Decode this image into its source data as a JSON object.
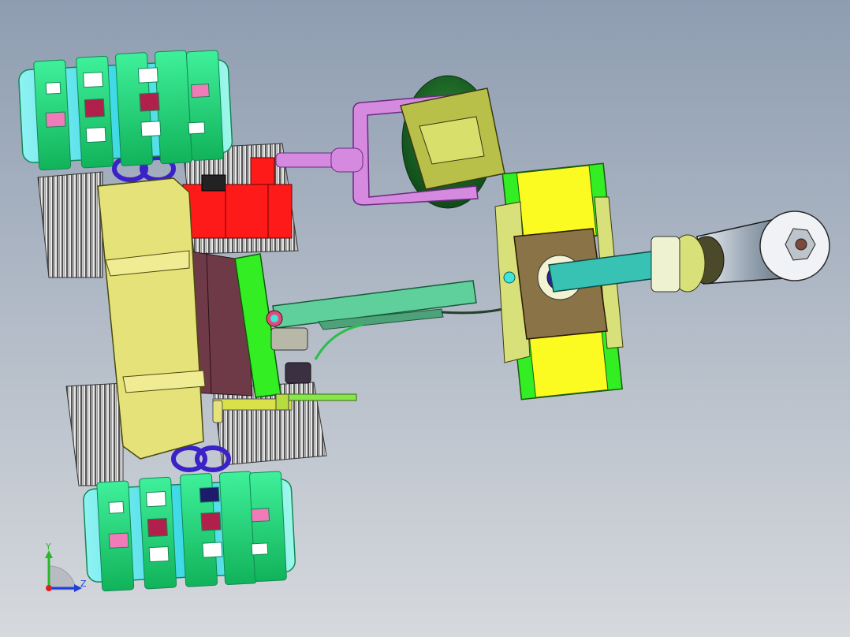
{
  "viewport": {
    "background_top": "#8e9db1",
    "background_bottom": "#d6d9dd"
  },
  "triad": {
    "y_label": "Y",
    "z_label": "Z",
    "y_color": "#2bb62b",
    "z_color": "#1f3fd8",
    "x_color": "#e02020"
  },
  "colors": {
    "wheel_green": "#22d47a",
    "wheel_cyan": "#41e5d9",
    "wheel_pink": "#f07bb8",
    "wheel_magenta": "#b0204a",
    "gear_grey": "#8c8c8c",
    "block_yellow": "#e6e27a",
    "block_red": "#ff1a1a",
    "bright_green": "#33ee22",
    "purple_handle": "#d58ae0",
    "olive": "#b9c04a",
    "dark_green": "#1d6b28",
    "yellow_pad": "#fbfb22",
    "brown": "#8a7346",
    "teal_rod": "#37c2b4",
    "seafoam_rod": "#5fcf9c",
    "steel": "#7b8896",
    "violet": "#4b2ccc"
  }
}
